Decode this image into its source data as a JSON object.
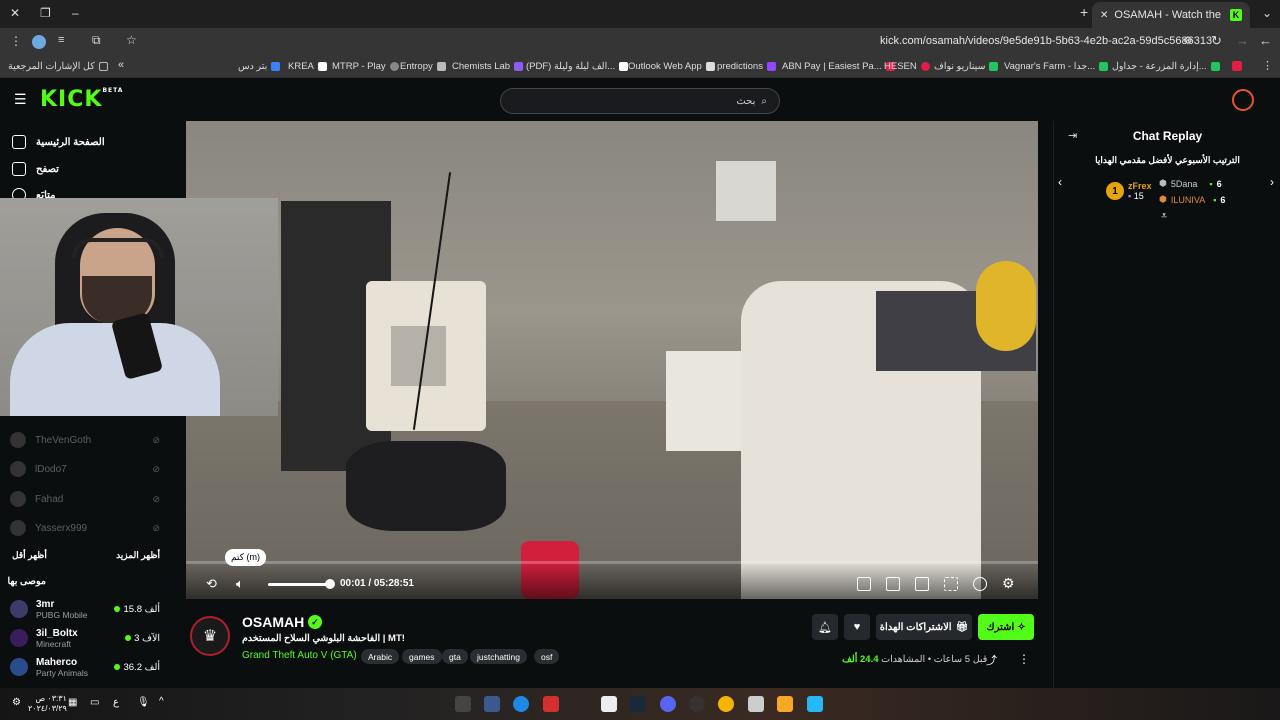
{
  "browser": {
    "tab_title": "OSAMAH - Watch the VOD",
    "tab_favicon": "K",
    "url": "kick.com/osamah/videos/9e5de91b-5b63-4e2b-ac2a-59d5c5686313",
    "bookmarks": [
      {
        "label": "كل الإشارات المرجعية",
        "color": "#9aa0a6"
      },
      {
        "label": "بتر دس",
        "color": "#3b82f6"
      },
      {
        "label": "KREA",
        "color": "#111111"
      },
      {
        "label": "MTRP - Play",
        "color": "#888888"
      },
      {
        "label": "Entropy",
        "color": "#bbbbbb"
      },
      {
        "label": "Chemists Lab",
        "color": "#8b5cf6"
      },
      {
        "label": "(PDF) الف ليلة وليلة...",
        "color": "#999999"
      },
      {
        "label": "Outlook Web App",
        "color": "#ffffff"
      },
      {
        "label": "predictions",
        "color": "#9146ff"
      },
      {
        "label": "ABN Pay | Easiest Pa...",
        "color": "#e11d48"
      },
      {
        "label": "HESEN",
        "color": "#e11d48"
      },
      {
        "label": "سيناريو نواف",
        "color": "#22c55e"
      },
      {
        "label": "Vagnar's Farm - جدا...",
        "color": "#22c55e"
      },
      {
        "label": "إدارة المزرعة - جداول...",
        "color": "#22c55e"
      }
    ]
  },
  "header": {
    "logo": "KICK",
    "logo_badge": "BETA",
    "search_placeholder": "بحث"
  },
  "sidebar": {
    "nav": [
      {
        "label": "الصفحة الرئيسية",
        "icon": "home-icon"
      },
      {
        "label": "تصفح",
        "icon": "browse-icon"
      },
      {
        "label": "متابَع",
        "icon": "heart-icon"
      }
    ],
    "following": [
      {
        "name": "TheVenGoth",
        "status": "offline"
      },
      {
        "name": "lDodo7",
        "status": "offline"
      },
      {
        "name": "Fahad",
        "status": "offline"
      },
      {
        "name": "Yasserx999",
        "status": "offline"
      }
    ],
    "show_more": "أظهر المزيد",
    "show_less": "أظهر أقل",
    "recommended_title": "موصى بها",
    "recommended": [
      {
        "name": "3mr",
        "category": "PUBG Mobile",
        "viewers": "15.8 ألف"
      },
      {
        "name": "3il_Boltx",
        "category": "Minecraft",
        "viewers": "3 الآف"
      },
      {
        "name": "Maherco",
        "category": "Party Animals",
        "viewers": "36.2 ألف"
      }
    ]
  },
  "player": {
    "progress": 0.0,
    "volume": 0.9,
    "time_current": "00:01",
    "time_total": "05:28:51",
    "mute_tooltip": "كتم (m)"
  },
  "chat": {
    "title": "Chat Replay",
    "leaderboard_title": "الترتيب الأسبوعي لأفضل مقدمي الهدايا",
    "leaders": [
      {
        "rank": "1",
        "name": "zFrex",
        "score": "15"
      },
      {
        "name": "5Dana",
        "score": "6"
      },
      {
        "name": "ILUNIVA",
        "score": "6"
      }
    ]
  },
  "channel": {
    "name": "OSAMAH",
    "title": "!MT | الفاحشة البلوشي السلاح المستخدم",
    "category": "Grand Theft Auto V (GTA)",
    "tags": [
      "Arabic",
      "games",
      "gta",
      "justchatting",
      "osf"
    ],
    "subscribe_label": "اشترك",
    "gift_label": "الاشتراكات الهداة",
    "time_ago": "قبل 5 ساعات",
    "views_label": "المشاهدات",
    "views_value": "24.4 ألف"
  },
  "taskbar": {
    "clock_time": "٠٣:٣١ ص",
    "clock_date": "٢٠٢٤/٠٣/٢٩",
    "lang": "ع"
  },
  "colors": {
    "accent": "#53fc18",
    "background": "#0b0e0f"
  }
}
